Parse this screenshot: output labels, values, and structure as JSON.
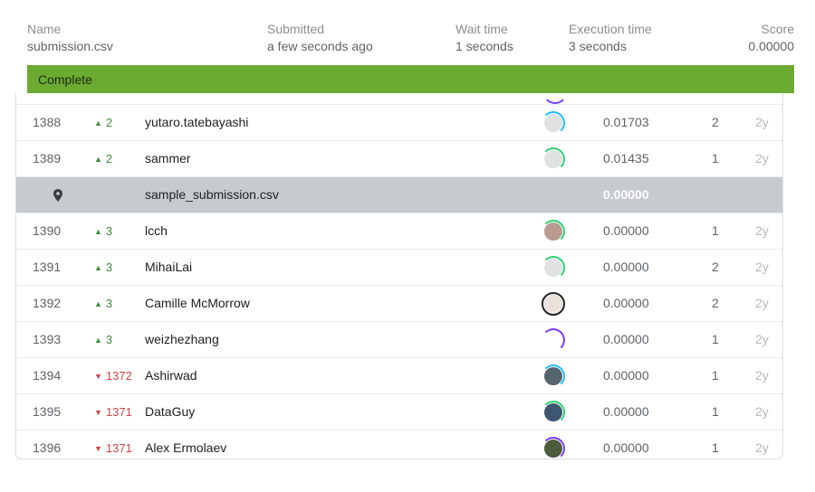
{
  "summary": {
    "name_label": "Name",
    "name_value": "submission.csv",
    "submitted_label": "Submitted",
    "submitted_value": "a few seconds ago",
    "wait_label": "Wait time",
    "wait_value": "1 seconds",
    "exec_label": "Execution time",
    "exec_value": "3 seconds",
    "score_label": "Score",
    "score_value": "0.00000",
    "status": "Complete",
    "status_color": "#6bab31"
  },
  "leaderboard": {
    "rows": [
      {
        "rank": "1388",
        "delta": "2",
        "dir": "up",
        "team": "yutaro.tatebayashi",
        "avatar": "kaggle-default-avatar",
        "score": "0.01703",
        "entries": "2",
        "last": "2y"
      },
      {
        "rank": "1389",
        "delta": "2",
        "dir": "up",
        "team": "sammer",
        "avatar": "kaggle-default-avatar",
        "score": "0.01435",
        "entries": "1",
        "last": "2y"
      },
      {
        "rank": "",
        "delta": "",
        "dir": "",
        "team": "sample_submission.csv",
        "avatar": "",
        "score": "0.00000",
        "entries": "",
        "last": ""
      },
      {
        "rank": "1390",
        "delta": "3",
        "dir": "up",
        "team": "lcch",
        "avatar": "anime-avatar",
        "score": "0.00000",
        "entries": "1",
        "last": "2y"
      },
      {
        "rank": "1391",
        "delta": "3",
        "dir": "up",
        "team": "MihaiLai",
        "avatar": "kaggle-default-avatar",
        "score": "0.00000",
        "entries": "2",
        "last": "2y"
      },
      {
        "rank": "1392",
        "delta": "3",
        "dir": "up",
        "team": "Camille McMorrow",
        "avatar": "portrait-avatar",
        "score": "0.00000",
        "entries": "2",
        "last": "2y"
      },
      {
        "rank": "1393",
        "delta": "3",
        "dir": "up",
        "team": "weizhezhang",
        "avatar": "empty-avatar",
        "score": "0.00000",
        "entries": "1",
        "last": "2y"
      },
      {
        "rank": "1394",
        "delta": "1372",
        "dir": "down",
        "team": "Ashirwad",
        "avatar": "photo-avatar",
        "score": "0.00000",
        "entries": "1",
        "last": "2y"
      },
      {
        "rank": "1395",
        "delta": "1371",
        "dir": "down",
        "team": "DataGuy",
        "avatar": "photo-avatar",
        "score": "0.00000",
        "entries": "1",
        "last": "2y"
      },
      {
        "rank": "1396",
        "delta": "1371",
        "dir": "down",
        "team": "Alex Ermolaev",
        "avatar": "photo-avatar",
        "score": "0.00000",
        "entries": "1",
        "last": "2y"
      }
    ]
  },
  "colors": {
    "up": "#3f8b3a",
    "down": "#d04545",
    "highlight_row": "#c6cbd0",
    "tier_purple": "#7a3cff",
    "tier_blue": "#20beff",
    "tier_green": "#2dd274"
  }
}
